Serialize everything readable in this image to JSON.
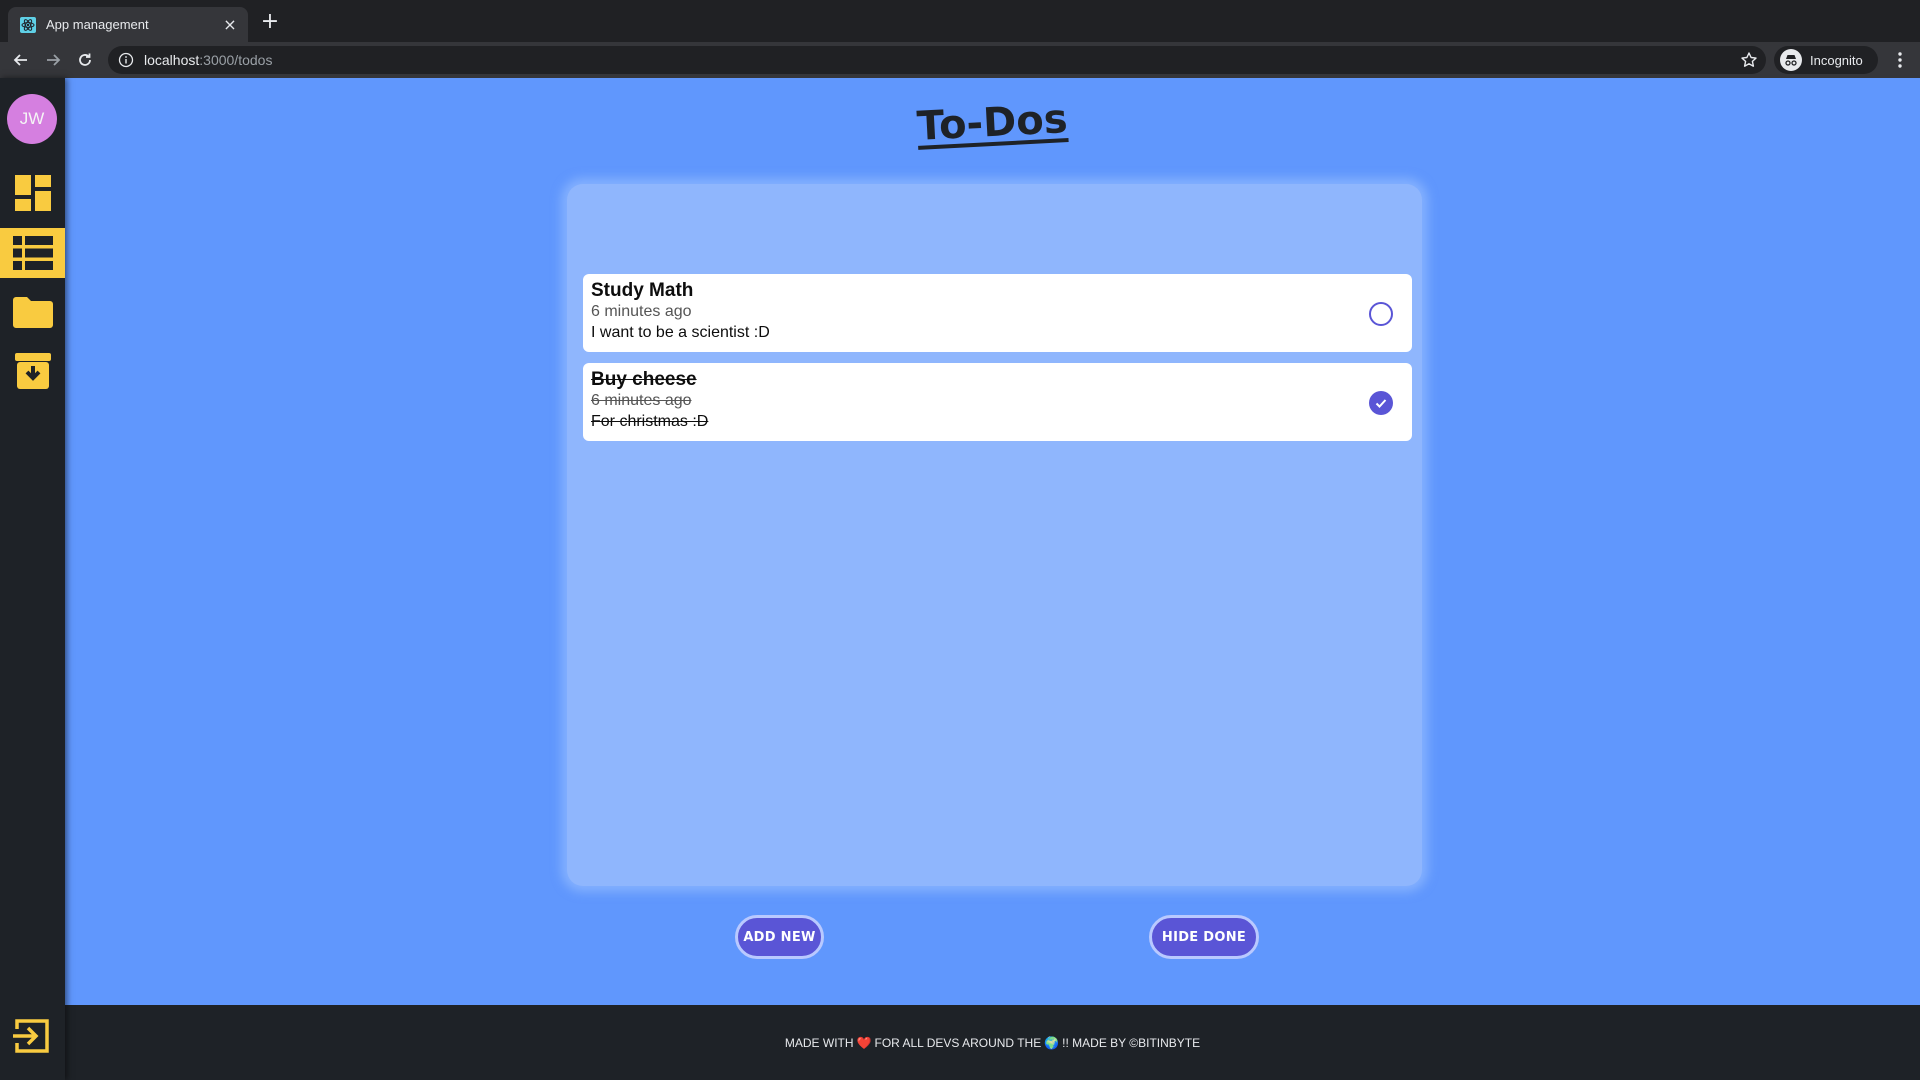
{
  "browser": {
    "tab_title": "App management",
    "tab_close": "×",
    "new_tab": "+",
    "url_host": "localhost",
    "url_rest": ":3000/todos",
    "incognito_label": "Incognito"
  },
  "sidebar": {
    "avatar_initials": "JW",
    "items": [
      {
        "name": "dashboard",
        "icon": "dashboard-icon",
        "active": false
      },
      {
        "name": "list",
        "icon": "list-icon",
        "active": true
      },
      {
        "name": "folder",
        "icon": "folder-icon",
        "active": false
      },
      {
        "name": "archive",
        "icon": "archive-download-icon",
        "active": false
      }
    ],
    "logout_icon": "logout-icon"
  },
  "page": {
    "title": "To-Dos"
  },
  "todos": [
    {
      "title": "Study Math",
      "time": "6 minutes ago",
      "description": "I want to be a scientist :D",
      "done": false
    },
    {
      "title": "Buy cheese",
      "time": "6 minutes ago",
      "description": "For christmas :D",
      "done": true
    }
  ],
  "actions": {
    "add_new": "ADD NEW",
    "hide_done": "HIDE DONE"
  },
  "footer": {
    "part1": "MADE WITH",
    "heart": "❤️",
    "part2": "FOR ALL DEVS AROUND THE",
    "globe": "🌍",
    "part3": "!! MADE BY ©BITINBYTE"
  },
  "colors": {
    "accent": "#f9cb40",
    "background": "#6097fd",
    "board": "#8fb6fd",
    "button": "#5a55d6",
    "avatar": "#d57fe0"
  }
}
